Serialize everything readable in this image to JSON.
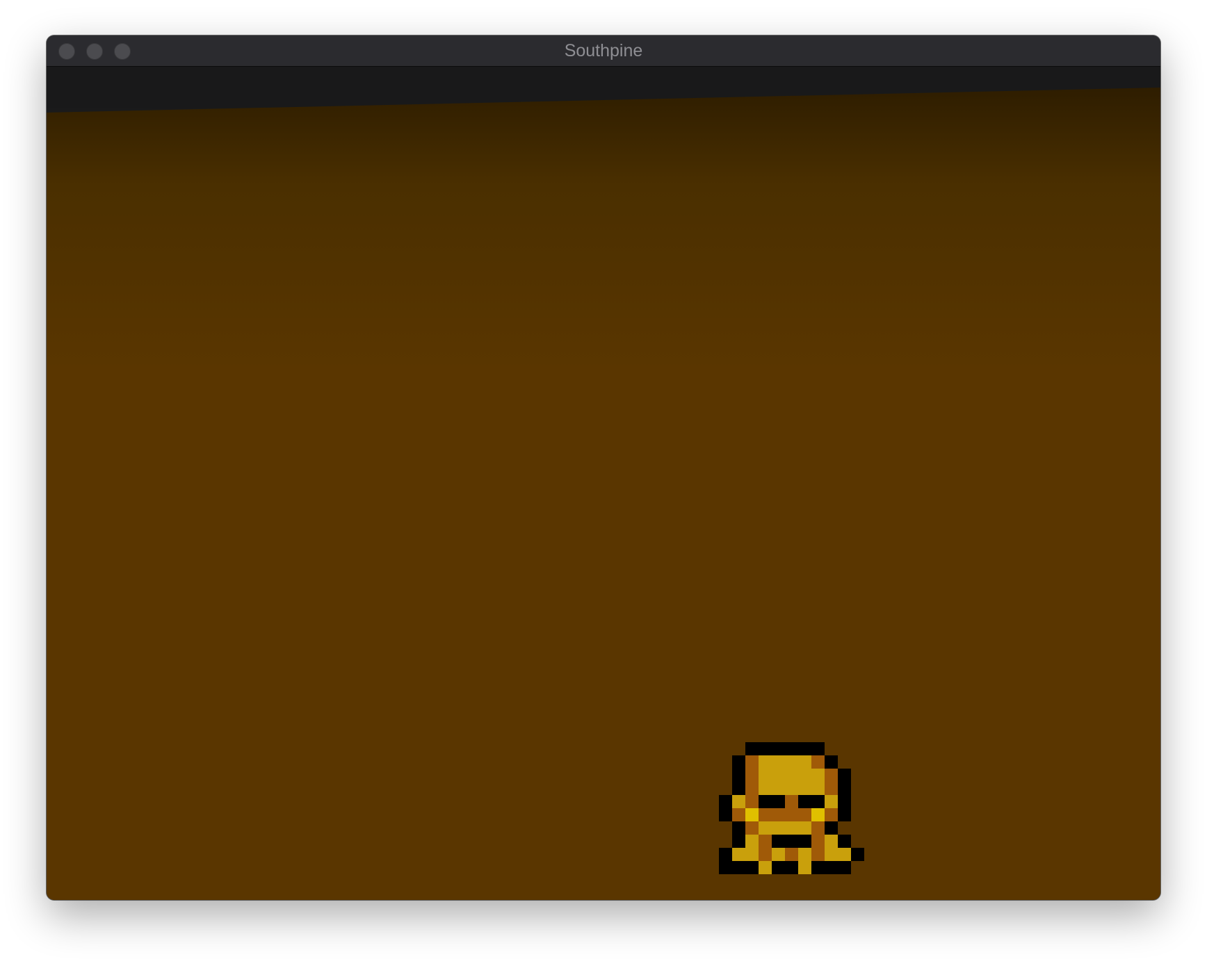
{
  "window": {
    "title": "Southpine"
  },
  "colors": {
    "ground_top": "#2e1d00",
    "ground_mid": "#4a2f00",
    "ground": "#5a3600",
    "void": "#19191a",
    "sprite_gold": "#c9a00c",
    "sprite_brown": "#a05a08",
    "sprite_outline": "#000000",
    "sprite_highlight": "#e0c000"
  },
  "game": {
    "scene": "tilted-plane",
    "sprite": {
      "name": "gold-armored-character",
      "facing": "front"
    }
  }
}
